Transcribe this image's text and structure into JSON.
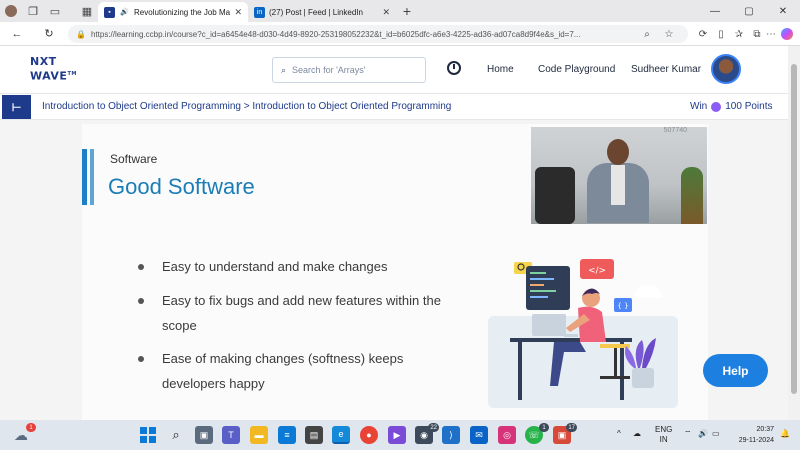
{
  "browser": {
    "tabs": [
      {
        "title": "Revolutionizing the Job Mar",
        "active": true
      },
      {
        "title": "(27) Post | Feed | LinkedIn",
        "active": false
      }
    ],
    "new_tab_symbol": "+",
    "url": "https://learning.ccbp.in/course?c_id=a6454e48-d030-4d49-8920-253198052232&t_id=b6025dfc-a6e3-4225-ad36-ad07ca8d9f4e&s_id=7..."
  },
  "header": {
    "logo_line1": "NXT",
    "logo_line2": "WAVE",
    "logo_tm": "TM",
    "search_placeholder": "Search for 'Arrays'",
    "nav_home": "Home",
    "nav_playground": "Code Playground",
    "user_name": "Sudheer Kumar"
  },
  "subheader": {
    "breadcrumb": "Introduction to Object Oriented Programming > Introduction to Object Oriented Programming",
    "win_label": "Win",
    "points_label": "100 Points"
  },
  "slide": {
    "kicker": "Software",
    "title": "Good Software",
    "bullets": [
      "Easy to understand and make changes",
      "Easy to fix bugs and add new features within the scope",
      "Ease of making changes (softness) keeps developers happy"
    ],
    "video_number": "507740",
    "illus_code_tag": "</>",
    "illus_braces": "{ }"
  },
  "help_label": "Help",
  "taskbar": {
    "weather_badge": "1",
    "teams_badge": "22",
    "whatsapp_badge": "1",
    "app_badge": "17",
    "lang_line1": "ENG",
    "lang_line2": "IN",
    "time": "20:37",
    "date": "29-11-2024"
  },
  "colors": {
    "brand_blue": "#1e3a8a",
    "slide_title": "#1b7db6",
    "help_button": "#1d7fe0",
    "points_coin": "#8b5cf6"
  }
}
